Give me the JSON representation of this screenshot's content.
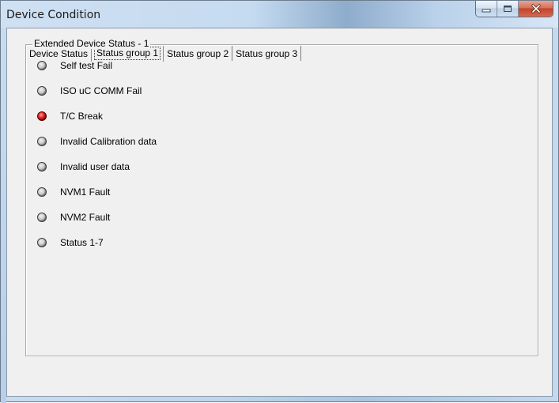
{
  "window": {
    "title": "Device Condition",
    "buttons": {
      "minimize_icon": "minimize-icon",
      "maximize_icon": "maximize-icon",
      "close_icon": "close-icon"
    }
  },
  "tabs": [
    {
      "label": "Device Status",
      "active": false
    },
    {
      "label": "Status group 1",
      "active": true
    },
    {
      "label": "Status group 2",
      "active": false
    },
    {
      "label": "Status group 3",
      "active": false
    }
  ],
  "group": {
    "label": "Extended Device Status - 1",
    "items": [
      {
        "label": "Self test Fail",
        "state": "off"
      },
      {
        "label": "ISO uC COMM Fail",
        "state": "off"
      },
      {
        "label": "T/C Break",
        "state": "on"
      },
      {
        "label": "Invalid Calibration data",
        "state": "off"
      },
      {
        "label": "Invalid user data",
        "state": "off"
      },
      {
        "label": "NVM1 Fault",
        "state": "off"
      },
      {
        "label": "NVM2 Fault",
        "state": "off"
      },
      {
        "label": "Status 1-7",
        "state": "off"
      }
    ]
  },
  "colors": {
    "led_on": "#e21b1b",
    "led_off": "#c9c9c9",
    "client_bg": "#f0f0f0"
  }
}
